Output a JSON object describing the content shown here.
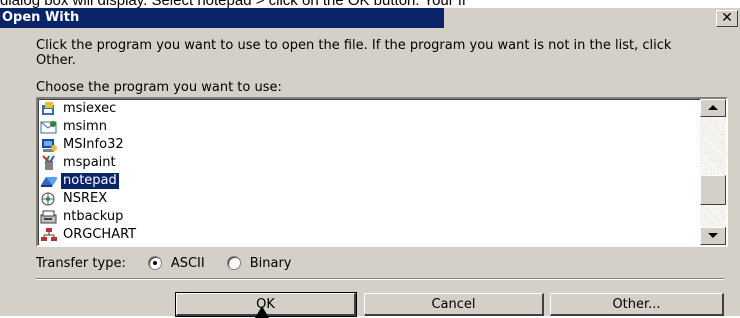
{
  "caption": "dialog box will display. Select notepad > click on the OK button. Your fi",
  "dialog": {
    "title": "Open With",
    "close_glyph": "✕",
    "instructions": "Click the program you want to use to open the file.  If the program you want is not in the list, click Other.",
    "choose_label": "Choose the program you want to use:",
    "programs": [
      {
        "label": "msiexec",
        "icon": "msiexec-icon",
        "selected": false
      },
      {
        "label": "msimn",
        "icon": "msimn-icon",
        "selected": false
      },
      {
        "label": "MSInfo32",
        "icon": "msinfo32-icon",
        "selected": false
      },
      {
        "label": "mspaint",
        "icon": "mspaint-icon",
        "selected": false
      },
      {
        "label": "notepad",
        "icon": "notepad-icon",
        "selected": true
      },
      {
        "label": "NSREX",
        "icon": "nsrex-icon",
        "selected": false
      },
      {
        "label": "ntbackup",
        "icon": "ntbackup-icon",
        "selected": false
      },
      {
        "label": "ORGCHART",
        "icon": "orgchart-icon",
        "selected": false
      }
    ],
    "transfer_type_label": "Transfer type:",
    "transfer_options": [
      {
        "label": "ASCII",
        "checked": true
      },
      {
        "label": "Binary",
        "checked": false
      }
    ],
    "buttons": {
      "ok": "OK",
      "cancel": "Cancel",
      "other": "Other..."
    }
  },
  "colors": {
    "titlebar": "#0a246a",
    "dialog_bg": "#d4d0c8",
    "selection": "#0a246a"
  }
}
